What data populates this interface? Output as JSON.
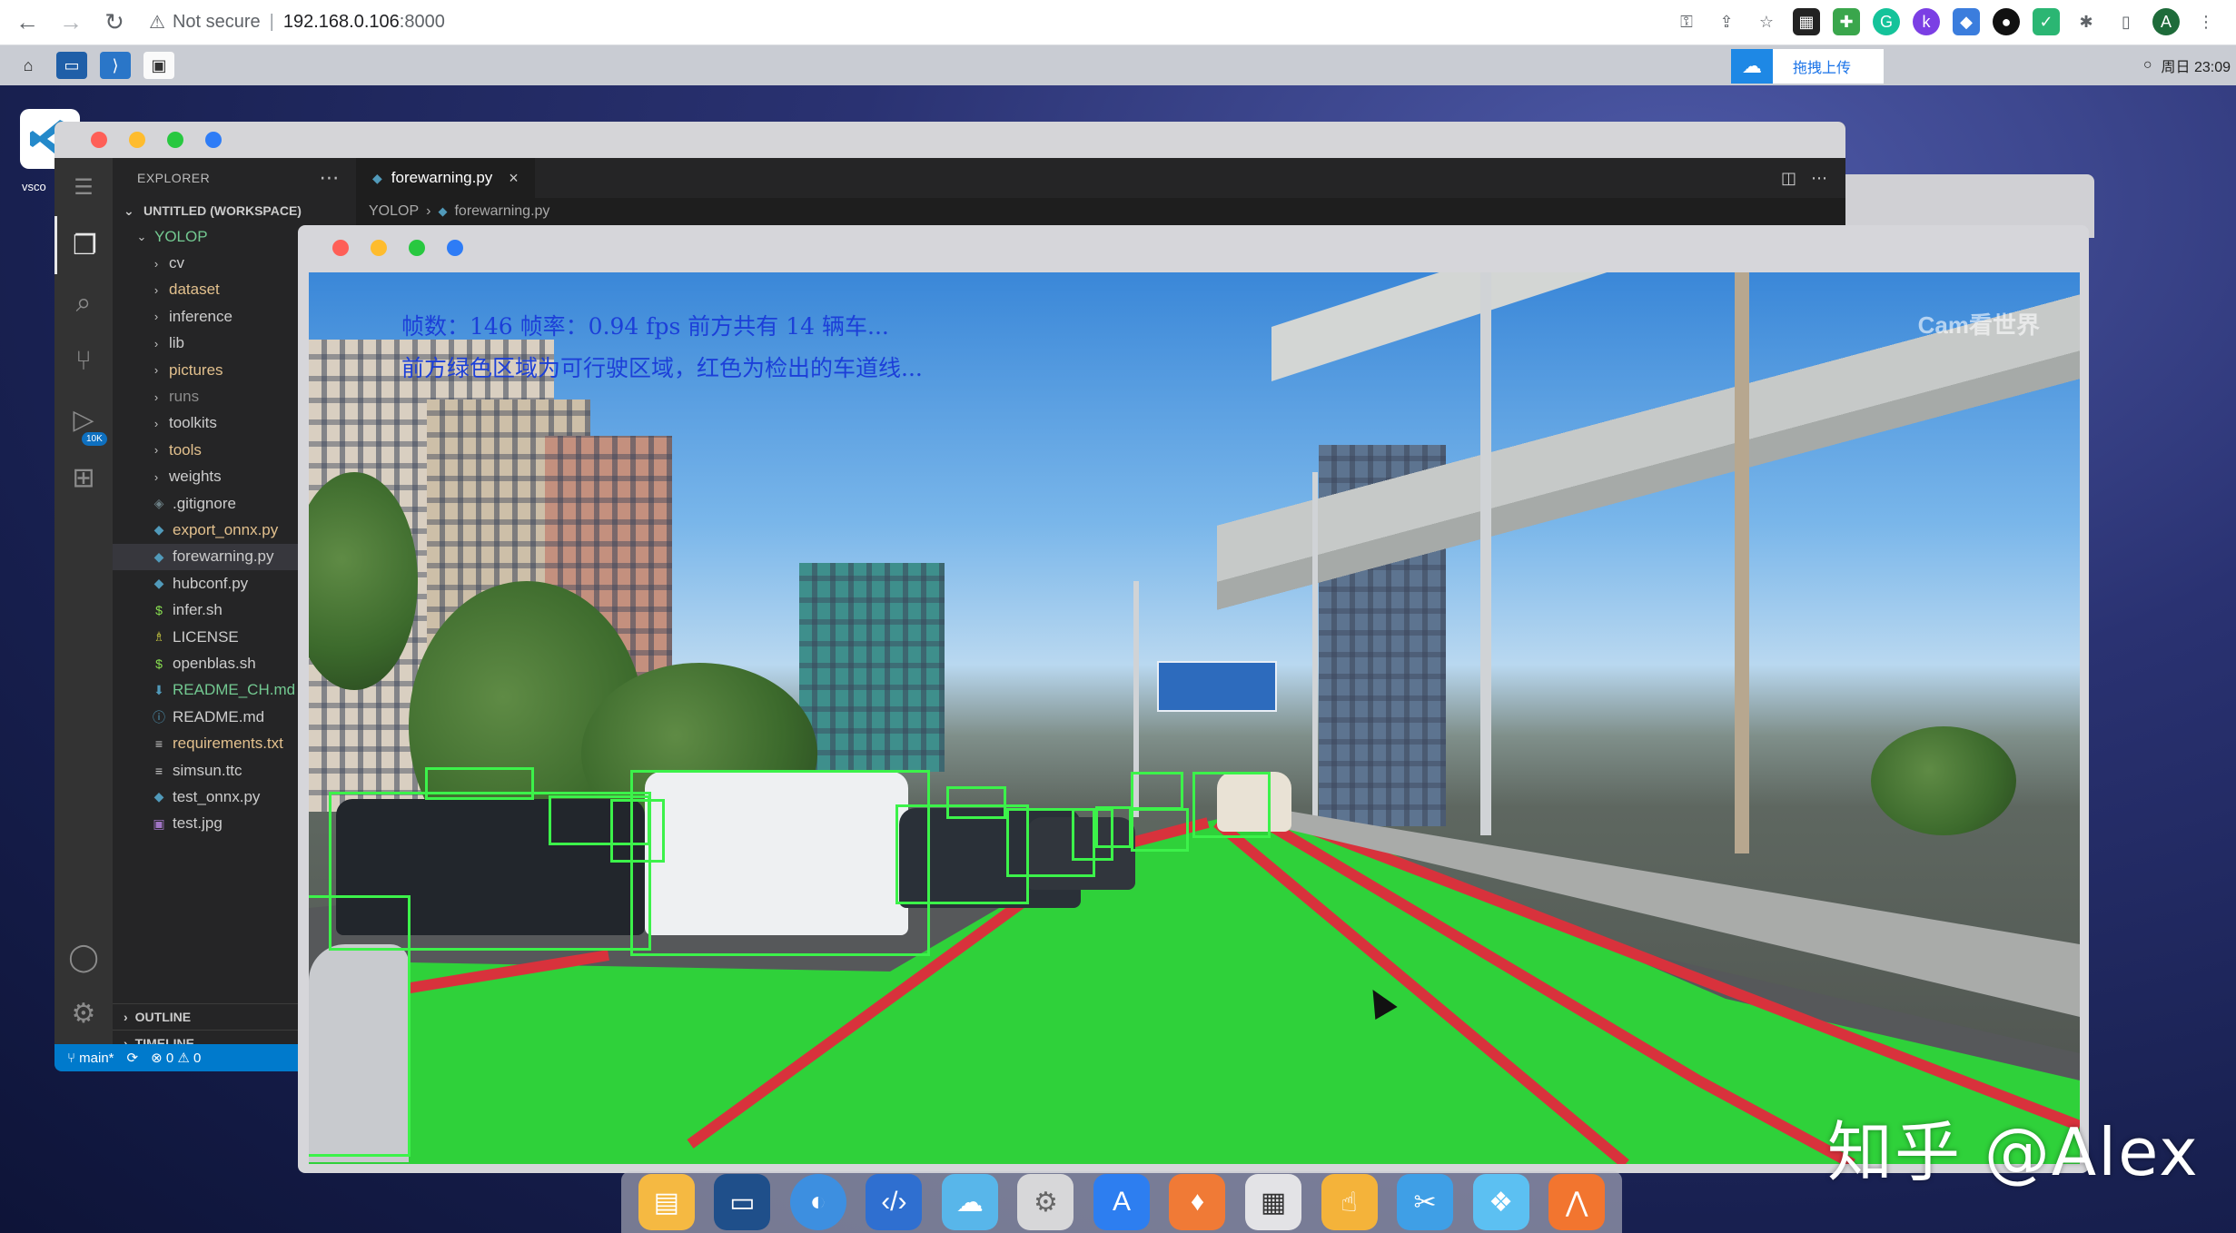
{
  "browser": {
    "security_label": "Not secure",
    "url": "192.168.0.106",
    "port": ":8000",
    "profile_initial": "A"
  },
  "top_panel": {
    "upload_label": "拖拽上传",
    "clock": "周日 23:09"
  },
  "desktop": {
    "vscode_label": "vsco"
  },
  "vscode": {
    "explorer_title": "EXPLORER",
    "workspace": "UNTITLED (WORKSPACE)",
    "root_folder": "YOLOP",
    "tree": [
      {
        "label": "cv",
        "kind": "folder",
        "color": "#cccccc"
      },
      {
        "label": "dataset",
        "kind": "folder",
        "color": "#e2c08d"
      },
      {
        "label": "inference",
        "kind": "folder",
        "color": "#cccccc"
      },
      {
        "label": "lib",
        "kind": "folder",
        "color": "#cccccc"
      },
      {
        "label": "pictures",
        "kind": "folder",
        "color": "#e2c08d"
      },
      {
        "label": "runs",
        "kind": "folder",
        "color": "#8c8c8c"
      },
      {
        "label": "toolkits",
        "kind": "folder",
        "color": "#cccccc"
      },
      {
        "label": "tools",
        "kind": "folder",
        "color": "#e2c08d"
      },
      {
        "label": "weights",
        "kind": "folder",
        "color": "#cccccc"
      },
      {
        "label": ".gitignore",
        "kind": "file",
        "icon": "◈",
        "icon_color": "#6d8086",
        "color": "#cccccc"
      },
      {
        "label": "export_onnx.py",
        "kind": "file",
        "icon": "◆",
        "icon_color": "#519aba",
        "color": "#e2c08d"
      },
      {
        "label": "forewarning.py",
        "kind": "file",
        "icon": "◆",
        "icon_color": "#519aba",
        "color": "#cccccc",
        "selected": true
      },
      {
        "label": "hubconf.py",
        "kind": "file",
        "icon": "◆",
        "icon_color": "#519aba",
        "color": "#cccccc"
      },
      {
        "label": "infer.sh",
        "kind": "file",
        "icon": "$",
        "icon_color": "#89e051",
        "color": "#cccccc"
      },
      {
        "label": "LICENSE",
        "kind": "file",
        "icon": "♗",
        "icon_color": "#cbcb41",
        "color": "#cccccc"
      },
      {
        "label": "openblas.sh",
        "kind": "file",
        "icon": "$",
        "icon_color": "#89e051",
        "color": "#cccccc"
      },
      {
        "label": "README_CH.md",
        "kind": "file",
        "icon": "⬇",
        "icon_color": "#519aba",
        "color": "#73c991"
      },
      {
        "label": "README.md",
        "kind": "file",
        "icon": "ⓘ",
        "icon_color": "#519aba",
        "color": "#cccccc"
      },
      {
        "label": "requirements.txt",
        "kind": "file",
        "icon": "≡",
        "icon_color": "#cccccc",
        "color": "#e2c08d"
      },
      {
        "label": "simsun.ttc",
        "kind": "file",
        "icon": "≡",
        "icon_color": "#cccccc",
        "color": "#cccccc"
      },
      {
        "label": "test_onnx.py",
        "kind": "file",
        "icon": "◆",
        "icon_color": "#519aba",
        "color": "#cccccc"
      },
      {
        "label": "test.jpg",
        "kind": "file",
        "icon": "▣",
        "icon_color": "#a074c4",
        "color": "#cccccc"
      }
    ],
    "outline": "OUTLINE",
    "timeline": "TIMELINE",
    "tab_label": "forewarning.py",
    "crumb_root": "YOLOP",
    "crumb_file": "forewarning.py",
    "status_branch": "main*",
    "status_errors": "0",
    "status_warnings": "0",
    "scm_badge": "10K"
  },
  "video": {
    "line1": "帧数：146  帧率：0.94 fps 前方共有 14 辆车...",
    "line2": "前方绿色区域为可行驶区域，红色为检出的车道线...",
    "cam_watermark": "Cam看世界"
  },
  "watermark": "知乎 @Alex",
  "colors": {
    "drivable": "#2fd13a",
    "lane": "#d8323c",
    "box": "#3cf24a",
    "overlay_text": "#1c3fd8"
  }
}
